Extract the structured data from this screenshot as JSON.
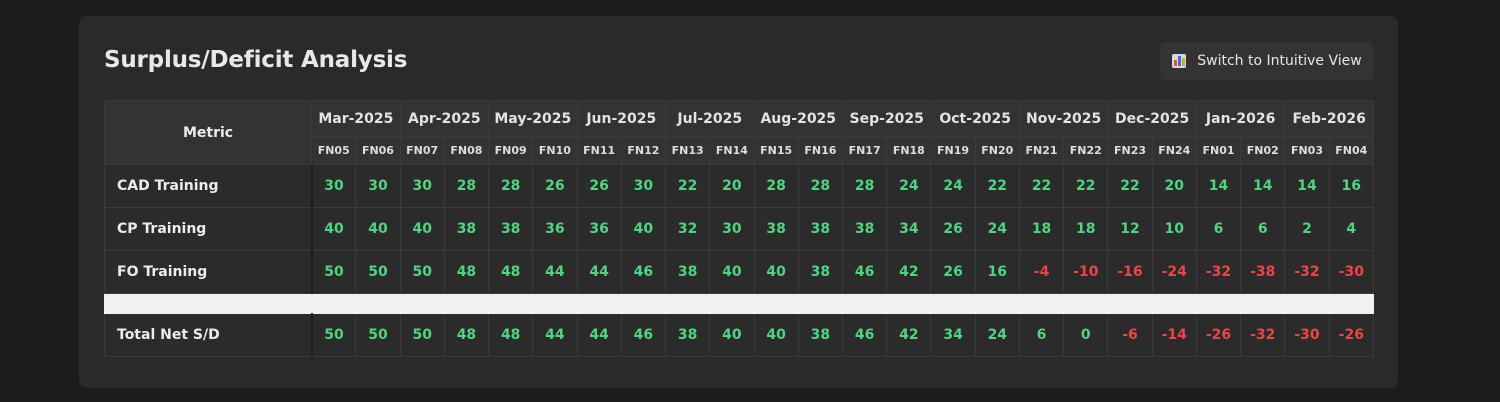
{
  "title": "Surplus/Deficit Analysis",
  "switch_button": {
    "label": "Switch to Intuitive View",
    "icon": "bar-chart-icon"
  },
  "colors": {
    "positive": "#4cd680",
    "negative": "#ef4444"
  },
  "table": {
    "metric_header": "Metric",
    "months": [
      "Mar-2025",
      "Apr-2025",
      "May-2025",
      "Jun-2025",
      "Jul-2025",
      "Aug-2025",
      "Sep-2025",
      "Oct-2025",
      "Nov-2025",
      "Dec-2025",
      "Jan-2026",
      "Feb-2026"
    ],
    "fortnights": [
      "FN05",
      "FN06",
      "FN07",
      "FN08",
      "FN09",
      "FN10",
      "FN11",
      "FN12",
      "FN13",
      "FN14",
      "FN15",
      "FN16",
      "FN17",
      "FN18",
      "FN19",
      "FN20",
      "FN21",
      "FN22",
      "FN23",
      "FN24",
      "FN01",
      "FN02",
      "FN03",
      "FN04"
    ],
    "rows": [
      {
        "label": "CAD Training",
        "values": [
          "30",
          "30",
          "30",
          "28",
          "28",
          "26",
          "26",
          "30",
          "22",
          "20",
          "28",
          "28",
          "28",
          "24",
          "24",
          "22",
          "22",
          "22",
          "22",
          "20",
          "14",
          "14",
          "14",
          "16"
        ]
      },
      {
        "label": "CP Training",
        "values": [
          "40",
          "40",
          "40",
          "38",
          "38",
          "36",
          "36",
          "40",
          "32",
          "30",
          "38",
          "38",
          "38",
          "34",
          "26",
          "24",
          "18",
          "18",
          "12",
          "10",
          "6",
          "6",
          "2",
          "4"
        ]
      },
      {
        "label": "FO Training",
        "values": [
          "50",
          "50",
          "50",
          "48",
          "48",
          "44",
          "44",
          "46",
          "38",
          "40",
          "40",
          "38",
          "46",
          "42",
          "26",
          "16",
          "-4",
          "-10",
          "-16",
          "-24",
          "-32",
          "-38",
          "-32",
          "-30"
        ]
      }
    ],
    "total": {
      "label": "Total Net S/D",
      "values": [
        "50",
        "50",
        "50",
        "48",
        "48",
        "44",
        "44",
        "46",
        "38",
        "40",
        "40",
        "38",
        "46",
        "42",
        "34",
        "24",
        "6",
        "0",
        "-6",
        "-14",
        "-26",
        "-32",
        "-30",
        "-26"
      ]
    }
  }
}
